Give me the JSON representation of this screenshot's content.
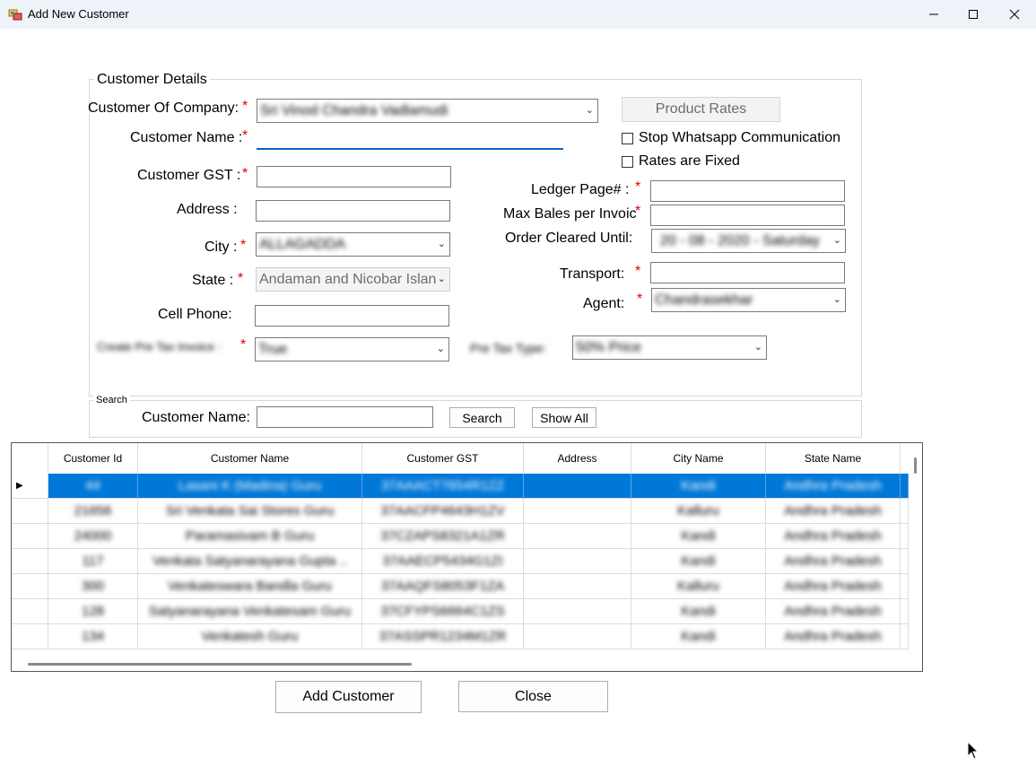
{
  "window": {
    "title": "Add New Customer"
  },
  "details": {
    "legend": "Customer Details",
    "company_label": "Customer Of Company:",
    "company_value": "Sri Vinod Chandra Vadlamudi",
    "name_label": "Customer Name :",
    "name_value": "",
    "gst_label": "Customer GST :",
    "address_label": "Address :",
    "city_label": "City :",
    "city_value": "ALLAGADDA",
    "state_label": "State :",
    "state_value": "Andaman and Nicobar Islan",
    "phone_label": "Cell Phone:",
    "invoice_label": "Create Pre Tax Invoice :",
    "invoice_value": "True",
    "product_rates": "Product Rates",
    "stop_whatsapp": "Stop Whatsapp Communication",
    "rates_fixed": "Rates are Fixed",
    "ledger_label": "Ledger Page# :",
    "maxbales_label": "Max Bales per Invoic",
    "order_label": "Order Cleared Until:",
    "order_value": "20 - 08 - 2020 - Saturday",
    "transport_label": "Transport:",
    "agent_label": "Agent:",
    "agent_value": "Chandrasekhar",
    "pretax_label": "Pre Tax Type:",
    "pretax_value": "50% Price",
    "required_mark": "*"
  },
  "search": {
    "legend": "Search",
    "name_label": "Customer Name:",
    "search_button": "Search",
    "show_all_button": "Show All"
  },
  "grid": {
    "columns": [
      "Customer Id",
      "Customer Name",
      "Customer GST",
      "Address",
      "City Name",
      "State Name"
    ],
    "rows": [
      [
        "44",
        "Lasani K (Madina) Guru",
        "37AAACT7654R1ZZ",
        "",
        "Kandi",
        "Andhra Pradesh"
      ],
      [
        "21656",
        "Sri Venkata Sai Stores Guru",
        "37AACFP4643H1ZV",
        "",
        "Kalluru",
        "Andhra Pradesh"
      ],
      [
        "24000",
        "Paramasivam B Guru",
        "37CZAPS8321A1ZR",
        "",
        "Kandi",
        "Andhra Pradesh"
      ],
      [
        "117",
        "Venkata Satyanarayana Gupta ..",
        "37AAECP5434G1ZI",
        "",
        "Kandi",
        "Andhra Pradesh"
      ],
      [
        "300",
        "Venkateswara Bandla Guru",
        "37AAQFS8053F1ZA",
        "",
        "Kalluru",
        "Andhra Pradesh"
      ],
      [
        "128",
        "Satyanarayana Venkatesam Guru",
        "37CFYPS6664C1ZS",
        "",
        "Kandi",
        "Andhra Pradesh"
      ],
      [
        "134",
        "Venkatesh Guru",
        "37ASSPR1234M1ZR",
        "",
        "Kandi",
        "Andhra Pradesh"
      ]
    ]
  },
  "buttons": {
    "add": "Add Customer",
    "close": "Close"
  },
  "colors": {
    "selection": "#0078d7",
    "required": "#e00000",
    "focus": "#0067c0"
  }
}
